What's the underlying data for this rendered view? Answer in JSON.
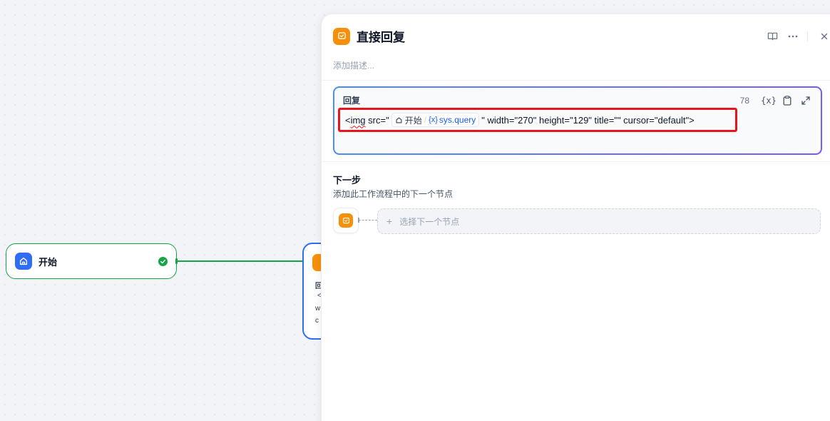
{
  "canvas": {
    "start_node": {
      "title": "开始"
    },
    "answer_node_peek": {
      "line1": "回",
      "line2": "<",
      "line3": "w",
      "line4": "c"
    }
  },
  "panel": {
    "title": "直接回复",
    "description_placeholder": "添加描述...",
    "reply": {
      "label": "回复",
      "char_count": "78",
      "tokens": {
        "pre": "<",
        "tag": "img",
        "attr": " src=\"",
        "var_node": "开始",
        "var_name": "sys.query",
        "post": "\" width=\"270\" height=\"129\" title=\"\" cursor=\"default\">"
      }
    },
    "next_step": {
      "title": "下一步",
      "subtitle": "添加此工作流程中的下一个节点",
      "select_label": "选择下一个节点",
      "plus": "+"
    }
  },
  "colors": {
    "start_accent": "#16a34a",
    "answer_accent": "#f79009",
    "selection_border": "#2f6df6",
    "variable": "#155eef",
    "highlight_box": "#e8141b"
  }
}
